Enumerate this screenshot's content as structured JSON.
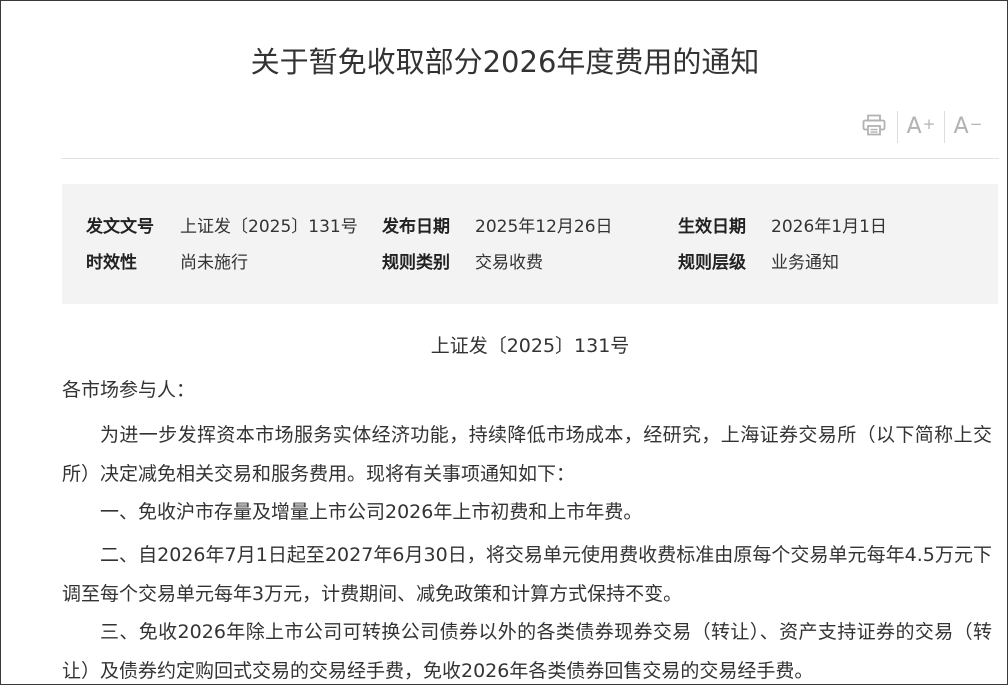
{
  "title": "关于暂免收取部分2026年度费用的通知",
  "toolbar": {
    "print_icon": "printer-icon",
    "font_increase_icon": "font-increase-icon",
    "font_decrease_icon": "font-decrease-icon",
    "font_glyph": "A",
    "plus_sign": "+",
    "minus_sign": "−"
  },
  "meta": {
    "doc_no_label": "发文文号",
    "doc_no_value": "上证发〔2025〕131号",
    "publish_label": "发布日期",
    "publish_value": "2025年12月26日",
    "effective_label": "生效日期",
    "effective_value": "2026年1月1日",
    "validity_label": "时效性",
    "validity_value": "尚未施行",
    "category_label": "规则类别",
    "category_value": "交易收费",
    "level_label": "规则层级",
    "level_value": "业务通知"
  },
  "body": {
    "doc_number": "上证发〔2025〕131号",
    "salutation": "各市场参与人：",
    "paragraphs": [
      "为进一步发挥资本市场服务实体经济功能，持续降低市场成本，经研究，上海证券交易所（以下简称上交所）决定减免相关交易和服务费用。现将有关事项通知如下：",
      "一、免收沪市存量及增量上市公司2026年上市初费和上市年费。",
      "二、自2026年7月1日起至2027年6月30日，将交易单元使用费收费标准由原每个交易单元每年4.5万元下调至每个交易单元每年3万元，计费期间、减免政策和计算方式保持不变。",
      "三、免收2026年除上市公司可转换公司债券以外的各类债券现券交易（转让）、资产支持证券的交易（转让）及债券约定购回式交易的交易经手费，免收2026年各类债券回售交易的交易经手费。"
    ]
  }
}
